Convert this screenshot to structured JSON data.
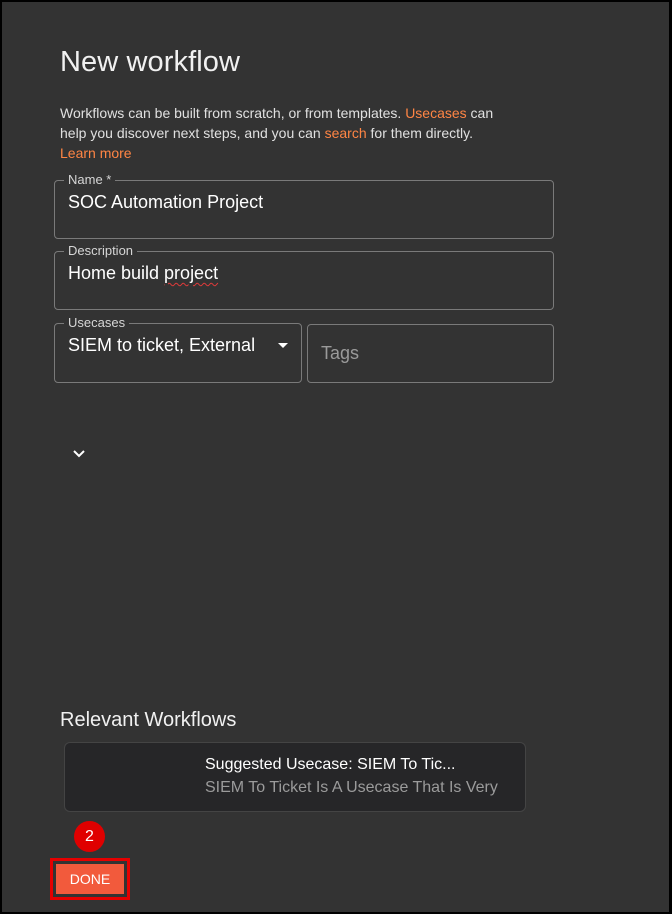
{
  "dialog": {
    "title": "New workflow",
    "intro": {
      "part1": "Workflows can be built from scratch, or from templates. ",
      "usecases_link": "Usecases",
      "part2": " can help you discover next steps, and you can ",
      "search_link": "search",
      "part3": " for them directly.",
      "learn_more_link": "Learn more"
    }
  },
  "form": {
    "name": {
      "label": "Name *",
      "value": "SOC Automation Project"
    },
    "description": {
      "label": "Description",
      "value_plain": "Home build ",
      "value_misspelled": "project"
    },
    "usecases": {
      "label": "Usecases",
      "value": "SIEM to ticket, External"
    },
    "tags": {
      "placeholder": "Tags"
    }
  },
  "icons": {
    "expand": "chevron-down-icon",
    "dropdown": "caret-down-icon"
  },
  "relevant": {
    "title": "Relevant Workflows",
    "items": [
      {
        "title": "Suggested Usecase: SIEM To Tic...",
        "subtitle": "SIEM To Ticket Is A Usecase That Is Very"
      }
    ]
  },
  "annotations": {
    "step": "2"
  },
  "actions": {
    "done_label": "DONE"
  },
  "colors": {
    "background": "#333333",
    "accent": "#ff8544",
    "done_button": "#f25a3c",
    "highlight_red": "#e50000"
  }
}
